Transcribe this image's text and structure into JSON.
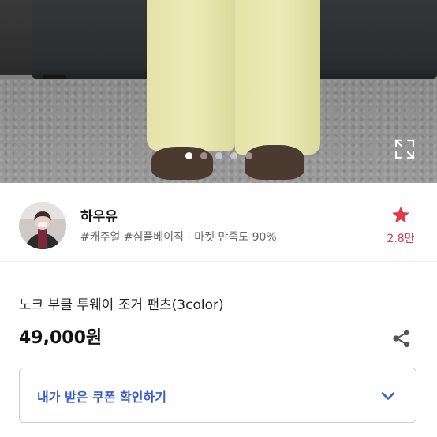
{
  "photo": {
    "carousel_total": 5,
    "carousel_active_index": 0,
    "expand_icon": "expand-icon"
  },
  "seller": {
    "name": "하우유",
    "tags": "#캐주얼 #심플베이직 · 마켓 만족도 90%",
    "favorite_icon": "star-icon",
    "favorite_count": "2.8만",
    "favorite_color": "#e0394a"
  },
  "product": {
    "title": "노크 부클 투웨이 조거 팬츠(3color)",
    "price": "49,000원",
    "share_icon": "share-icon"
  },
  "coupon": {
    "label": "내가 받은 쿠폰 확인하기",
    "label_color": "#3a5ec7",
    "chevron_icon": "chevron-down-icon"
  }
}
